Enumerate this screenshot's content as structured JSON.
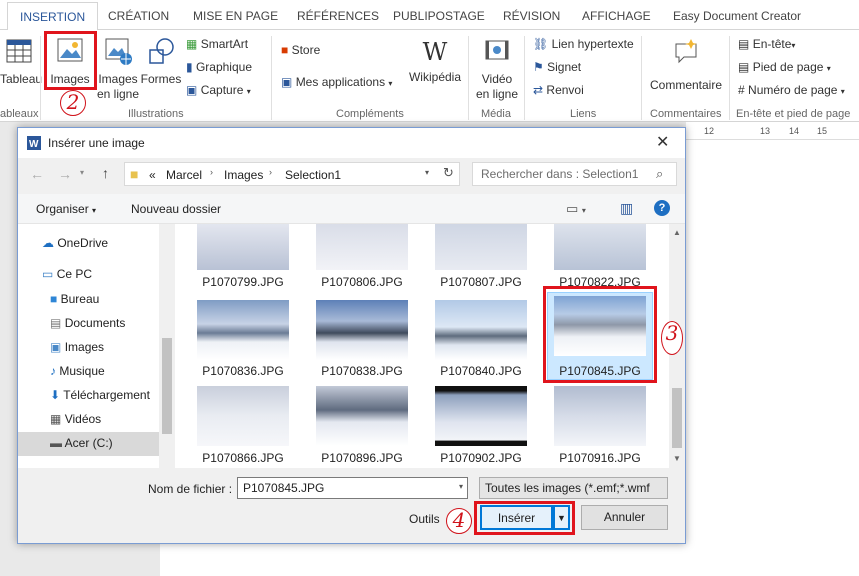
{
  "ribbon": {
    "tabs": [
      "INSERTION",
      "CRÉATION",
      "MISE EN PAGE",
      "RÉFÉRENCES",
      "PUBLIPOSTAGE",
      "RÉVISION",
      "AFFICHAGE",
      "Easy Document Creator"
    ],
    "tableau": "Tableau",
    "images": "Images",
    "images_en_ligne_1": "Images",
    "images_en_ligne_2": "en ligne",
    "formes": "Formes",
    "smartart": "SmartArt",
    "graphique": "Graphique",
    "capture": "Capture",
    "store": "Store",
    "mes_applications": "Mes applications",
    "wikipedia": "Wikipédia",
    "video_1": "Vidéo",
    "video_2": "en ligne",
    "lien_hypertexte": "Lien hypertexte",
    "signet": "Signet",
    "renvoi": "Renvoi",
    "commentaire": "Commentaire",
    "en_tete": "En-tête",
    "pied_de_page": "Pied de page",
    "numero_de_page": "Numéro de page",
    "groups": {
      "tableaux": "ableaux",
      "illustrations": "Illustrations",
      "complements": "Compléments",
      "media": "Média",
      "liens": "Liens",
      "commentaires": "Commentaires",
      "entete_pied": "En-tête et pied de page"
    }
  },
  "ruler": {
    "marks": [
      "12",
      "13",
      "14",
      "15"
    ]
  },
  "annotations": {
    "a2": "2",
    "a3": "3",
    "a4": "4"
  },
  "dialog": {
    "title": "Insérer une image",
    "path": [
      "Marcel",
      "Images",
      "Selection1"
    ],
    "path_prefix": "«",
    "search_placeholder": "Rechercher dans : Selection1",
    "organiser": "Organiser",
    "nouveau_dossier": "Nouveau dossier",
    "nav": [
      "OneDrive",
      "Ce PC",
      "Bureau",
      "Documents",
      "Images",
      "Musique",
      "Téléchargement",
      "Vidéos",
      "Acer (C:)"
    ],
    "files": [
      {
        "name": "P1070799.JPG"
      },
      {
        "name": "P1070806.JPG"
      },
      {
        "name": "P1070807.JPG"
      },
      {
        "name": "P1070822.JPG"
      },
      {
        "name": "P1070836.JPG"
      },
      {
        "name": "P1070838.JPG"
      },
      {
        "name": "P1070840.JPG"
      },
      {
        "name": "P1070845.JPG",
        "selected": true
      },
      {
        "name": "P1070866.JPG"
      },
      {
        "name": "P1070896.JPG"
      },
      {
        "name": "P1070902.JPG"
      },
      {
        "name": "P1070916.JPG"
      }
    ],
    "filename_label": "Nom de fichier :",
    "filename_value": "P1070845.JPG",
    "filetype_value": "Toutes les images (*.emf;*.wmf",
    "outils": "Outils",
    "inserer": "Insérer",
    "annuler": "Annuler"
  },
  "colors": {
    "accent": "#2b579a",
    "highlight_red": "#e0141c",
    "selection": "#cce8ff"
  }
}
